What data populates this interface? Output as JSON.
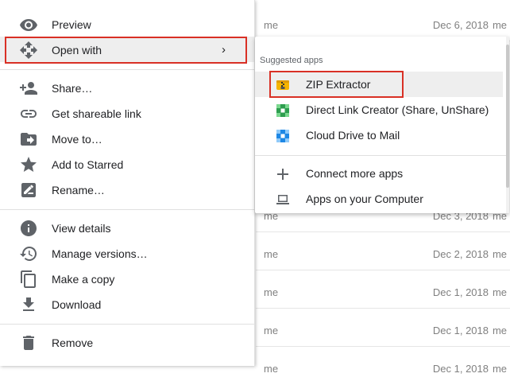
{
  "file_list": {
    "rows": [
      {
        "owner": "me",
        "date": "Dec 6, 2018",
        "owner2": "me"
      },
      {
        "owner": "me",
        "date": "Dec 3, 2018",
        "owner2": "me"
      },
      {
        "owner": "me",
        "date": "Dec 2, 2018",
        "owner2": "me"
      },
      {
        "owner": "me",
        "date": "Dec 1, 2018",
        "owner2": "me"
      },
      {
        "owner": "me",
        "date": "Dec 1, 2018",
        "owner2": "me"
      },
      {
        "owner": "me",
        "date": "Dec 1, 2018",
        "owner2": "me"
      }
    ]
  },
  "context_menu": {
    "items": [
      {
        "label": "Preview",
        "icon": "eye-icon"
      },
      {
        "label": "Open with",
        "icon": "move-arrows-icon",
        "chevron": "›"
      },
      {
        "label": "Share…",
        "icon": "add-person-icon"
      },
      {
        "label": "Get shareable link",
        "icon": "link-icon"
      },
      {
        "label": "Move to…",
        "icon": "folder-move-icon"
      },
      {
        "label": "Add to Starred",
        "icon": "star-icon"
      },
      {
        "label": "Rename…",
        "icon": "edit-icon"
      },
      {
        "label": "View details",
        "icon": "info-icon"
      },
      {
        "label": "Manage versions…",
        "icon": "history-icon"
      },
      {
        "label": "Make a copy",
        "icon": "copy-icon"
      },
      {
        "label": "Download",
        "icon": "download-icon"
      },
      {
        "label": "Remove",
        "icon": "trash-icon"
      }
    ]
  },
  "submenu": {
    "heading": "Suggested apps",
    "apps": [
      {
        "label": "ZIP Extractor",
        "icon": "zip-icon"
      },
      {
        "label": "Direct Link Creator (Share, UnShare)",
        "icon": "green-app-icon"
      },
      {
        "label": "Cloud Drive to Mail",
        "icon": "blue-app-icon"
      }
    ],
    "actions": [
      {
        "label": "Connect more apps",
        "icon": "plus-icon"
      },
      {
        "label": "Apps on your Computer",
        "icon": "laptop-icon"
      }
    ]
  },
  "colors": {
    "highlight_border": "#d93025",
    "highlight_bg": "#eeeeee",
    "icon_gray": "#5f6368"
  }
}
